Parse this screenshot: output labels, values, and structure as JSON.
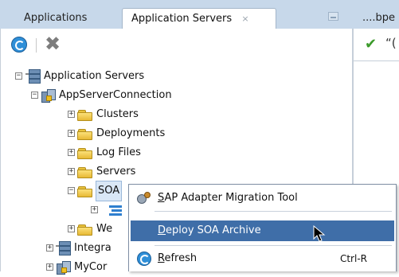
{
  "tabs": {
    "inactive_label": "Applications",
    "active_label": "Application Servers",
    "close_glyph": "×",
    "right_label": "....bpe"
  },
  "toolbar": {
    "refresh_icon": "refresh-icon",
    "delete_icon": "delete-icon",
    "delete_glyph": "✖"
  },
  "right_panel": {
    "check_glyph": "✔",
    "quote_glyph": "“("
  },
  "tree": {
    "root": "Application Servers",
    "connection": "AppServerConnection",
    "clusters": "Clusters",
    "deployments": "Deployments",
    "log_files": "Log Files",
    "servers": "Servers",
    "soa": "SOA",
    "web": "We",
    "integration": "Integra",
    "my_connection": "MyCor",
    "expand_plus": "+",
    "expand_minus": "−"
  },
  "context_menu": {
    "items": [
      {
        "label": "SAP Adapter Migration Tool",
        "icon": "adapter-icon",
        "mnemonic": "S",
        "rest": "AP Adapter Migration Tool"
      },
      {
        "label": "Deploy SOA Archive",
        "icon": "",
        "mnemonic": "D",
        "rest": "eploy SOA Archive"
      },
      {
        "label": "Refresh",
        "icon": "refresh-icon",
        "mnemonic": "R",
        "rest": "efresh",
        "shortcut": "Ctrl-R"
      }
    ]
  },
  "colors": {
    "tab_strip": "#c7d8ea",
    "menu_highlight": "#3f6ea8",
    "folder": "#e8b935"
  }
}
